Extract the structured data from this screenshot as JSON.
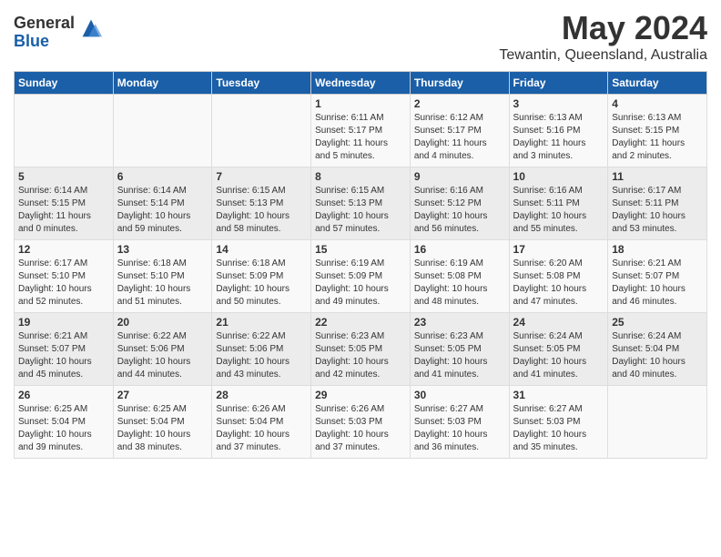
{
  "logo": {
    "general": "General",
    "blue": "Blue"
  },
  "title": "May 2024",
  "location": "Tewantin, Queensland, Australia",
  "days_of_week": [
    "Sunday",
    "Monday",
    "Tuesday",
    "Wednesday",
    "Thursday",
    "Friday",
    "Saturday"
  ],
  "weeks": [
    [
      {
        "day": "",
        "info": ""
      },
      {
        "day": "",
        "info": ""
      },
      {
        "day": "",
        "info": ""
      },
      {
        "day": "1",
        "info": "Sunrise: 6:11 AM\nSunset: 5:17 PM\nDaylight: 11 hours\nand 5 minutes."
      },
      {
        "day": "2",
        "info": "Sunrise: 6:12 AM\nSunset: 5:17 PM\nDaylight: 11 hours\nand 4 minutes."
      },
      {
        "day": "3",
        "info": "Sunrise: 6:13 AM\nSunset: 5:16 PM\nDaylight: 11 hours\nand 3 minutes."
      },
      {
        "day": "4",
        "info": "Sunrise: 6:13 AM\nSunset: 5:15 PM\nDaylight: 11 hours\nand 2 minutes."
      }
    ],
    [
      {
        "day": "5",
        "info": "Sunrise: 6:14 AM\nSunset: 5:15 PM\nDaylight: 11 hours\nand 0 minutes."
      },
      {
        "day": "6",
        "info": "Sunrise: 6:14 AM\nSunset: 5:14 PM\nDaylight: 10 hours\nand 59 minutes."
      },
      {
        "day": "7",
        "info": "Sunrise: 6:15 AM\nSunset: 5:13 PM\nDaylight: 10 hours\nand 58 minutes."
      },
      {
        "day": "8",
        "info": "Sunrise: 6:15 AM\nSunset: 5:13 PM\nDaylight: 10 hours\nand 57 minutes."
      },
      {
        "day": "9",
        "info": "Sunrise: 6:16 AM\nSunset: 5:12 PM\nDaylight: 10 hours\nand 56 minutes."
      },
      {
        "day": "10",
        "info": "Sunrise: 6:16 AM\nSunset: 5:11 PM\nDaylight: 10 hours\nand 55 minutes."
      },
      {
        "day": "11",
        "info": "Sunrise: 6:17 AM\nSunset: 5:11 PM\nDaylight: 10 hours\nand 53 minutes."
      }
    ],
    [
      {
        "day": "12",
        "info": "Sunrise: 6:17 AM\nSunset: 5:10 PM\nDaylight: 10 hours\nand 52 minutes."
      },
      {
        "day": "13",
        "info": "Sunrise: 6:18 AM\nSunset: 5:10 PM\nDaylight: 10 hours\nand 51 minutes."
      },
      {
        "day": "14",
        "info": "Sunrise: 6:18 AM\nSunset: 5:09 PM\nDaylight: 10 hours\nand 50 minutes."
      },
      {
        "day": "15",
        "info": "Sunrise: 6:19 AM\nSunset: 5:09 PM\nDaylight: 10 hours\nand 49 minutes."
      },
      {
        "day": "16",
        "info": "Sunrise: 6:19 AM\nSunset: 5:08 PM\nDaylight: 10 hours\nand 48 minutes."
      },
      {
        "day": "17",
        "info": "Sunrise: 6:20 AM\nSunset: 5:08 PM\nDaylight: 10 hours\nand 47 minutes."
      },
      {
        "day": "18",
        "info": "Sunrise: 6:21 AM\nSunset: 5:07 PM\nDaylight: 10 hours\nand 46 minutes."
      }
    ],
    [
      {
        "day": "19",
        "info": "Sunrise: 6:21 AM\nSunset: 5:07 PM\nDaylight: 10 hours\nand 45 minutes."
      },
      {
        "day": "20",
        "info": "Sunrise: 6:22 AM\nSunset: 5:06 PM\nDaylight: 10 hours\nand 44 minutes."
      },
      {
        "day": "21",
        "info": "Sunrise: 6:22 AM\nSunset: 5:06 PM\nDaylight: 10 hours\nand 43 minutes."
      },
      {
        "day": "22",
        "info": "Sunrise: 6:23 AM\nSunset: 5:05 PM\nDaylight: 10 hours\nand 42 minutes."
      },
      {
        "day": "23",
        "info": "Sunrise: 6:23 AM\nSunset: 5:05 PM\nDaylight: 10 hours\nand 41 minutes."
      },
      {
        "day": "24",
        "info": "Sunrise: 6:24 AM\nSunset: 5:05 PM\nDaylight: 10 hours\nand 41 minutes."
      },
      {
        "day": "25",
        "info": "Sunrise: 6:24 AM\nSunset: 5:04 PM\nDaylight: 10 hours\nand 40 minutes."
      }
    ],
    [
      {
        "day": "26",
        "info": "Sunrise: 6:25 AM\nSunset: 5:04 PM\nDaylight: 10 hours\nand 39 minutes."
      },
      {
        "day": "27",
        "info": "Sunrise: 6:25 AM\nSunset: 5:04 PM\nDaylight: 10 hours\nand 38 minutes."
      },
      {
        "day": "28",
        "info": "Sunrise: 6:26 AM\nSunset: 5:04 PM\nDaylight: 10 hours\nand 37 minutes."
      },
      {
        "day": "29",
        "info": "Sunrise: 6:26 AM\nSunset: 5:03 PM\nDaylight: 10 hours\nand 37 minutes."
      },
      {
        "day": "30",
        "info": "Sunrise: 6:27 AM\nSunset: 5:03 PM\nDaylight: 10 hours\nand 36 minutes."
      },
      {
        "day": "31",
        "info": "Sunrise: 6:27 AM\nSunset: 5:03 PM\nDaylight: 10 hours\nand 35 minutes."
      },
      {
        "day": "",
        "info": ""
      }
    ]
  ]
}
